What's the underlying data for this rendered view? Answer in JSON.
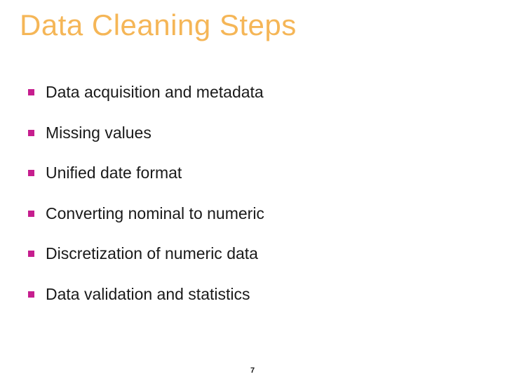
{
  "title": "Data Cleaning Steps",
  "bullets": [
    "Data acquisition and metadata",
    "Missing values",
    "Unified date format",
    "Converting nominal to numeric",
    "Discretization of numeric data",
    "Data validation and statistics"
  ],
  "page_number": "7",
  "colors": {
    "title": "#f5b657",
    "bullet_marker": "#c61e8e",
    "text": "#1a1a1a"
  }
}
